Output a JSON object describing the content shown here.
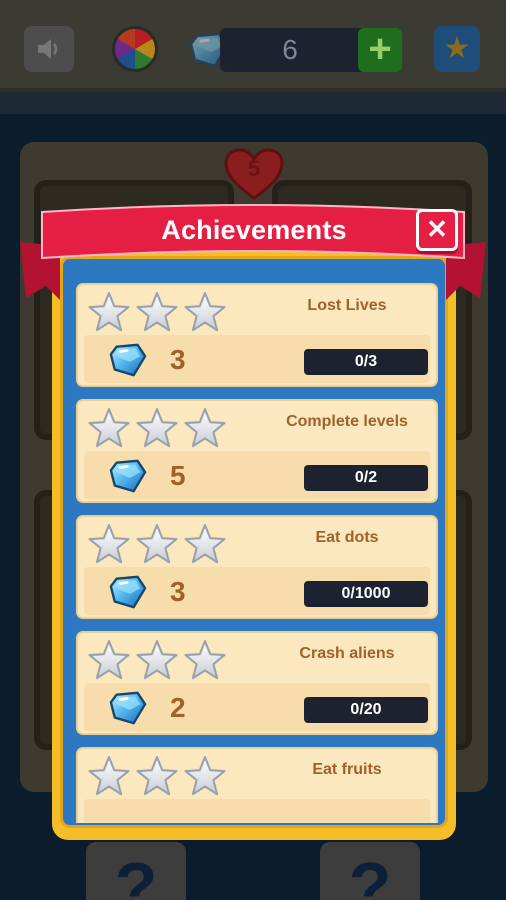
{
  "topbar": {
    "gem_count": "6",
    "add_label": "+"
  },
  "background": {
    "lives": "5",
    "question_mark": "?"
  },
  "dialog": {
    "title": "Achievements",
    "close_label": "✕"
  },
  "achievements": [
    {
      "title": "Lost Lives",
      "reward": "3",
      "progress": "0/3",
      "stars_earned": 0,
      "stars_total": 3
    },
    {
      "title": "Complete levels",
      "reward": "5",
      "progress": "0/2",
      "stars_earned": 0,
      "stars_total": 3
    },
    {
      "title": "Eat dots",
      "reward": "3",
      "progress": "0/1000",
      "stars_earned": 0,
      "stars_total": 3
    },
    {
      "title": "Crash aliens",
      "reward": "2",
      "progress": "0/20",
      "stars_earned": 0,
      "stars_total": 3
    },
    {
      "title": "Eat fruits",
      "reward": "",
      "progress": "",
      "stars_earned": 0,
      "stars_total": 3
    }
  ],
  "icons": {
    "reward": "gem-icon",
    "star": "star-icon",
    "sound": "speaker-icon",
    "wheel": "spin-wheel-icon"
  },
  "colors": {
    "ribbon": "#e41f43",
    "modal_frame": "#f5bd28",
    "modal_inner": "#2d78c0",
    "card": "#fbe8be",
    "text_brown": "#a0622a",
    "bar": "#1d2230"
  }
}
